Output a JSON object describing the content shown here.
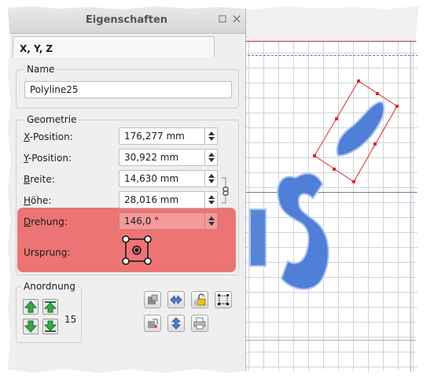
{
  "panel": {
    "title": "Eigenschaften",
    "tab_label": "X, Y, Z",
    "name_group": {
      "legend": "Name",
      "value": "Polyline25"
    },
    "geometry_group": {
      "legend": "Geometrie",
      "fields": [
        {
          "label_ul": "X",
          "label_rest": "-Position:",
          "value": "176,277 mm"
        },
        {
          "label_ul": "Y",
          "label_rest": "-Position:",
          "value": "30,922 mm"
        },
        {
          "label_ul": "B",
          "label_rest": "reite:",
          "value": "14,630 mm"
        },
        {
          "label_ul": "H",
          "label_rest": "öhe:",
          "value": "28,016 mm"
        },
        {
          "label_ul": "D",
          "label_rest": "rehung:",
          "value": "146,0 °"
        }
      ],
      "origin_label": "Ursprung:"
    },
    "arrangement_group": {
      "legend": "Anordnung",
      "level": "15"
    }
  },
  "icons": {
    "window_float": "float-icon",
    "window_close": "close-icon",
    "chain_link": "chain-link-icon",
    "origin": "origin-selector-icon",
    "level_up": "raise-icon",
    "level_top": "raise-to-top-icon",
    "level_down": "lower-icon",
    "level_bottom": "lower-to-bottom-icon",
    "flip_h": "flip-horizontal-icon",
    "flip_v": "flip-vertical-icon",
    "lock": "lock-icon",
    "size_lock": "size-lock-icon",
    "frame_tool": "frame-icon",
    "print": "print-icon",
    "shape_a": "shape-icon",
    "shape_b": "shape-outline-icon"
  },
  "colors": {
    "highlight": "#ec7474",
    "shape_fill": "#4f7fd6",
    "selection": "#e0282c",
    "level_green": "#3aa64a"
  }
}
